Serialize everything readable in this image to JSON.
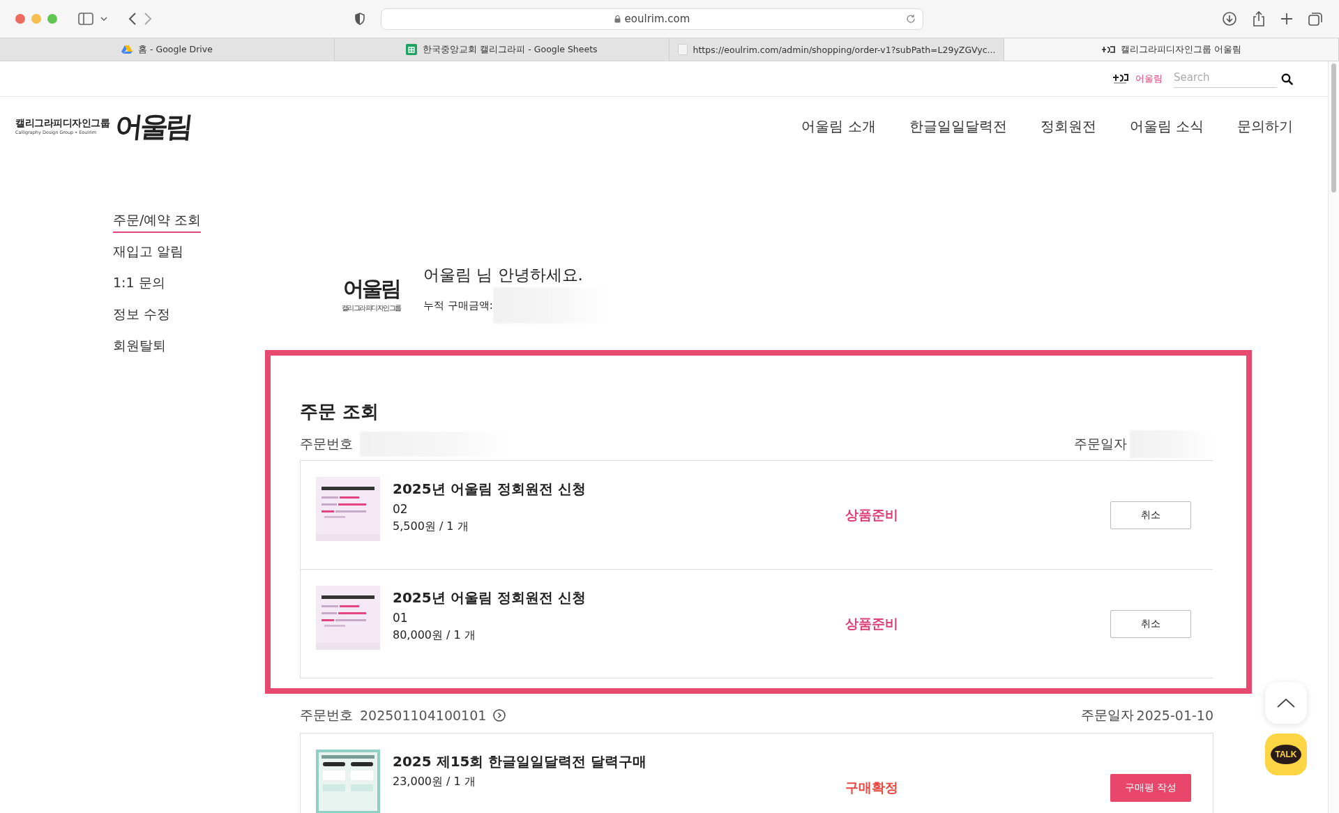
{
  "browser": {
    "url": "eoulrim.com",
    "tabs": [
      {
        "title": "홈 - Google Drive",
        "selected": false
      },
      {
        "title": "한국중앙교회 캘리그라피 - Google Sheets",
        "selected": false
      },
      {
        "title": "https://eoulrim.com/admin/shopping/order-v1?subPath=L29yZGVyc...",
        "selected": false
      },
      {
        "title": "캘리그라피디자인그룹 어울림",
        "selected": true
      }
    ]
  },
  "header": {
    "brand_name": "캘리그라피디자인그룹",
    "brand_sub": "Calligraphy Design Group • Eoulrim",
    "logo_text": "어울림",
    "top_link": "어울림",
    "search": {
      "placeholder": "Search"
    },
    "nav": [
      "어울림 소개",
      "한글일일달력전",
      "정회원전",
      "어울림 소식",
      "문의하기"
    ]
  },
  "sidebar": [
    {
      "label": "주문/예약 조회",
      "selected": true
    },
    {
      "label": "재입고 알림",
      "selected": false
    },
    {
      "label": "1:1 문의",
      "selected": false
    },
    {
      "label": "정보 수정",
      "selected": false
    },
    {
      "label": "회원탈퇴",
      "selected": false
    }
  ],
  "profile": {
    "logo_text": "어울림",
    "logo_sub": "캘리그라피디자인그룹",
    "greeting": "어울림 님 안녕하세요.",
    "total_label": "누적 구매금액:"
  },
  "orders": [
    {
      "highlighted": true,
      "heading": "주문 조회",
      "number_label": "주문번호",
      "date_label": "주문일자",
      "items": [
        {
          "kind": "pending",
          "title": "2025년 어울림 정회원전 신청",
          "option": "02",
          "price": "5,500원 / 1 개",
          "status": "상품준비",
          "action": "취소"
        },
        {
          "kind": "pending",
          "title": "2025년 어울림 정회원전 신청",
          "option": "01",
          "price": "80,000원 / 1 개",
          "status": "상품준비",
          "action": "취소"
        }
      ]
    },
    {
      "highlighted": false,
      "number_label": "주문번호",
      "number": "202501104100101",
      "date_label": "주문일자",
      "date": "2025-01-10",
      "items": [
        {
          "kind": "confirmed",
          "title": "2025 제15회 한글일일달력전 달력구매",
          "price": "23,000원 / 1 개",
          "status": "구매확정",
          "action": "구매평 작성"
        }
      ]
    }
  ],
  "floating": {
    "talk_label": "TALK"
  }
}
